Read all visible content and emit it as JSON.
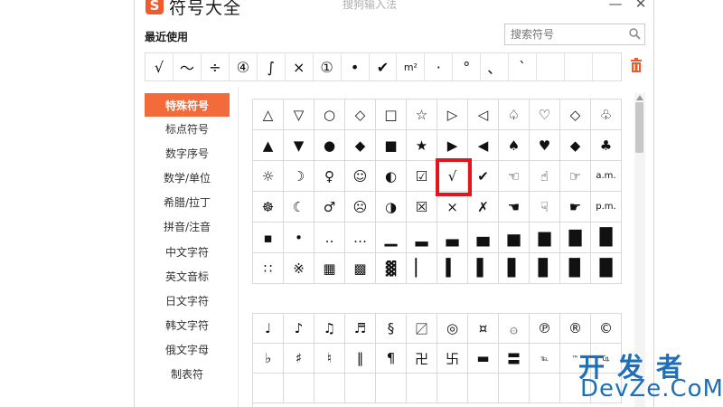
{
  "titlebar": {
    "logo_glyph": "S",
    "title": "符号大全",
    "ime_name": "搜狗输入法",
    "minimize_label": "—",
    "close_label": "✕"
  },
  "recent": {
    "title": "最近使用",
    "search_placeholder": "搜索符号",
    "symbols": [
      "√",
      "～",
      "÷",
      "④",
      "∫",
      "×",
      "①",
      "•",
      "✔",
      "m²",
      "·",
      "°",
      "、",
      "`",
      "",
      "",
      ""
    ]
  },
  "categories": [
    {
      "label": "特殊符号",
      "active": true
    },
    {
      "label": "标点符号",
      "active": false
    },
    {
      "label": "数字序号",
      "active": false
    },
    {
      "label": "数学/单位",
      "active": false
    },
    {
      "label": "希腊/拉丁",
      "active": false
    },
    {
      "label": "拼音/注音",
      "active": false
    },
    {
      "label": "中文字符",
      "active": false
    },
    {
      "label": "英文音标",
      "active": false
    },
    {
      "label": "日文字符",
      "active": false
    },
    {
      "label": "韩文字符",
      "active": false
    },
    {
      "label": "俄文字母",
      "active": false
    },
    {
      "label": "制表符",
      "active": false
    }
  ],
  "grid1": [
    "△",
    "▽",
    "○",
    "◇",
    "□",
    "☆",
    "▷",
    "◁",
    "♤",
    "♡",
    "◇",
    "♧",
    "▲",
    "▼",
    "●",
    "◆",
    "■",
    "★",
    "▶",
    "◀",
    "♠",
    "♥",
    "◆",
    "♣",
    "☼",
    "☽",
    "♀",
    "☺",
    "◐",
    "☑",
    "√",
    "✔",
    "☜",
    "☝",
    "☞",
    "a.m.",
    "☸",
    "☾",
    "♂",
    "☹",
    "◑",
    "☒",
    "×",
    "✗",
    "☚",
    "☟",
    "☛",
    "p.m.",
    "▪",
    "•",
    "‥",
    "…",
    "▁",
    "▂",
    "▃",
    "▄",
    "▅",
    "▆",
    "▇",
    "█",
    "∷",
    "※",
    "▦",
    "▩",
    "▓",
    "▏",
    "▍",
    "▌",
    "▋",
    "▊",
    "▉",
    "█"
  ],
  "grid2": [
    "♩",
    "♪",
    "♫",
    "♬",
    "§",
    "〼",
    "◎",
    "¤",
    "۞",
    "℗",
    "®",
    "©",
    "♭",
    "♯",
    "♮",
    "‖",
    "¶",
    "卍",
    "卐",
    "▬",
    "〓",
    "℡",
    "™",
    "㏇",
    "",
    "",
    "",
    "",
    "",
    "",
    "",
    "",
    "",
    "",
    "",
    ""
  ],
  "watermark": {
    "cn": "开发者",
    "en": "DevZe.CoM"
  }
}
